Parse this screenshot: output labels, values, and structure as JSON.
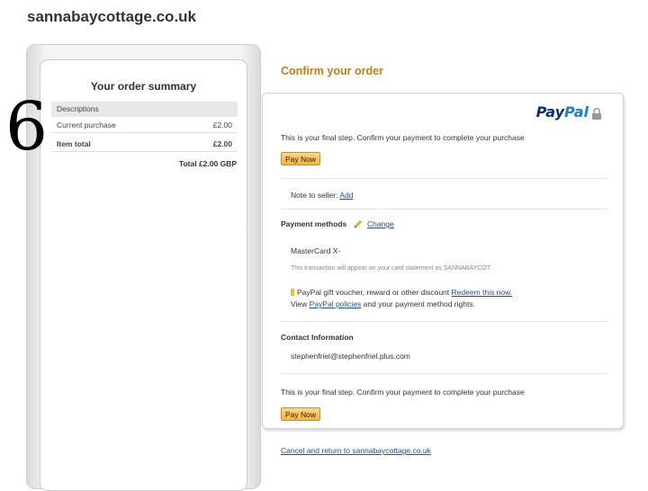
{
  "site": {
    "title": "sannabaycottage.co.uk"
  },
  "step_number": "6",
  "summary": {
    "title": "Your order summary",
    "header": "Descriptions",
    "rows": [
      {
        "label": "Current purchase",
        "value": "£2.00"
      },
      {
        "label": "Item total",
        "value": "£2.00"
      }
    ],
    "total": "Total £2.00 GBP"
  },
  "confirm": {
    "title": "Confirm your order",
    "logo_pay": "Pay",
    "logo_pal": "Pal",
    "final_step": "This is your final step. Confirm your payment to complete your purchase",
    "pay_now": "Pay Now",
    "note_label": "Note to seller:",
    "note_link": "Add",
    "payment_methods_title": "Payment methods",
    "change_link": "Change",
    "card": "MasterCard X-",
    "statement_note": "This transaction will appear on your card statement as SANNABAYCOT.",
    "voucher_text": "PayPal gift voucher, reward or other discount",
    "redeem_link": "Redeem this now.",
    "view_prefix": "View",
    "policies_link": "PayPal policies",
    "view_suffix": "and your payment method rights.",
    "contact_title": "Contact Information",
    "email": "stephenfriel@stephenfriel.plus.com",
    "final_step_2": "This is your final step. Confirm your payment to complete your purchase",
    "pay_now_2": "Pay Now"
  },
  "cancel_link": "Cancel and return to sannabaycottage.co.uk",
  "colors": {
    "accent": "#c07c1a",
    "link": "#1a4fa5",
    "paypal_dark": "#0a2f7a",
    "paypal_light": "#1a7fd1",
    "button": "#f5b340"
  }
}
